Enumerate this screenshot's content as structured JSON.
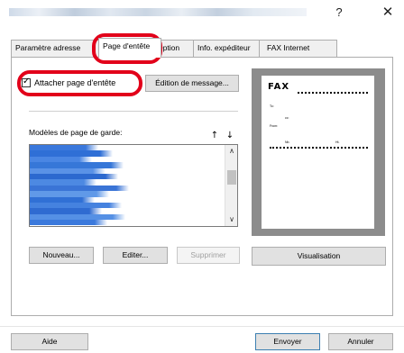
{
  "window": {
    "help_label": "?",
    "close_label": "✕"
  },
  "tabs": [
    {
      "label": "Paramètre adresse"
    },
    {
      "label": "Page d'entête"
    },
    {
      "label": "Option"
    },
    {
      "label": "Info. expéditeur"
    },
    {
      "label": "FAX Internet"
    }
  ],
  "cover_page": {
    "attach_label": "Attacher page d'entête",
    "attach_checked": true,
    "check_mark": "✓",
    "edit_message_label": "Édition de message...",
    "templates_label": "Modèles de page de garde:",
    "move_up_label": "↑",
    "move_down_label": "↓",
    "list_item_colors": [
      "#3a78dc",
      "#2f6fd6",
      "#4a86e3",
      "#3677d8",
      "#5a92e6",
      "#2c69cf",
      "#4d89e2",
      "#3a74d6",
      "#6099e8",
      "#3070d5",
      "#4582df",
      "#2f6bd1",
      "#5590e5",
      "#3b79dc"
    ],
    "new_label": "Nouveau...",
    "edit_label": "Editer...",
    "delete_label": "Supprimer",
    "preview_label": "Visualisation"
  },
  "preview": {
    "fax_title": "FAX",
    "to_label": "To:",
    "cc_label": "cc:",
    "from_label": "From:",
    "pages_label": "Nb.",
    "date_label": "Ht."
  },
  "footer": {
    "help_label": "Aide",
    "send_label": "Envoyer",
    "cancel_label": "Annuler"
  },
  "colors": {
    "annotation": "#e2001a",
    "selection": "#3a78dc"
  }
}
